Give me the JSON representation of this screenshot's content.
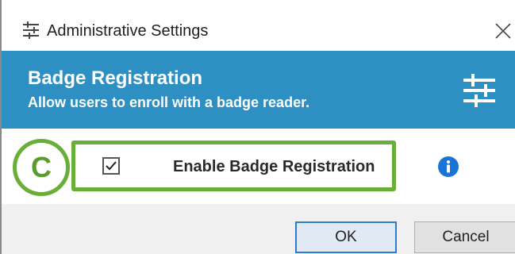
{
  "window": {
    "title": "Administrative Settings",
    "title_icon": "settings-sliders-icon",
    "close_icon": "close-icon"
  },
  "header": {
    "title": "Badge Registration",
    "subtitle": "Allow users to enroll with a badge reader.",
    "icon": "settings-sliders-icon",
    "background_color": "#2e8fc3"
  },
  "callout": {
    "letter": "C",
    "color": "#6aae3a"
  },
  "setting": {
    "label": "Enable Badge Registration",
    "checked": true,
    "info_icon": "info-icon",
    "info_color": "#1a73d9"
  },
  "footer": {
    "ok_label": "OK",
    "cancel_label": "Cancel"
  }
}
